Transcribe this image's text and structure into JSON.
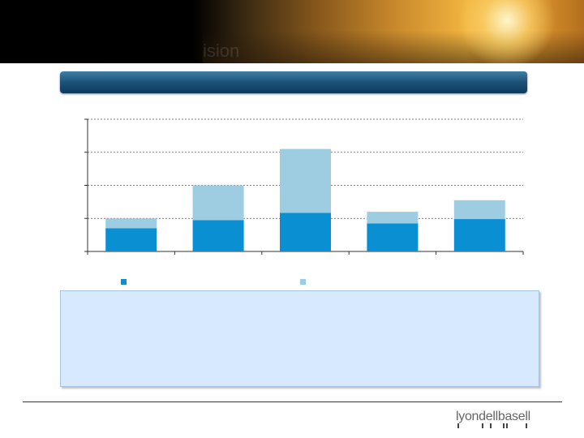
{
  "header": {
    "faded_title": "ision"
  },
  "logo": {
    "text": "lyondellbasell"
  },
  "colors": {
    "series_dark": "#0a8fd3",
    "series_light": "#9ecde2",
    "title_bar": "#1d5278",
    "info_box": "#d6e9ff"
  },
  "chart_data": {
    "type": "bar",
    "stacked": true,
    "categories": [
      "",
      "",
      "",
      "",
      ""
    ],
    "series": [
      {
        "values": [
          0.7,
          0.95,
          1.17,
          0.85,
          0.98
        ]
      },
      {
        "values": [
          0.3,
          1.05,
          1.93,
          0.35,
          0.57
        ]
      }
    ],
    "ylim": [
      0,
      4
    ],
    "y_gridlines": [
      1,
      2,
      3,
      4
    ],
    "grid": "dashed horizontal",
    "legend": "bottom"
  }
}
